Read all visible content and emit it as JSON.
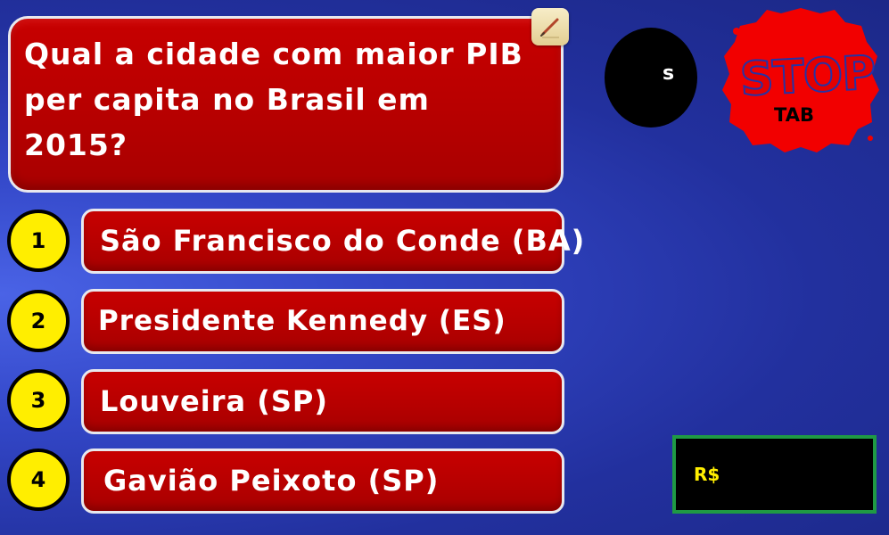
{
  "question": {
    "text_line1": "Qual a cidade com maior PIB",
    "text_line2": "per capita no Brasil em 2015?"
  },
  "edit_icon": "pencil-edit-icon",
  "answers": [
    {
      "number": "1",
      "text": "São Francisco do Conde (BA)"
    },
    {
      "number": "2",
      "text": "Presidente Kennedy (ES)"
    },
    {
      "number": "3",
      "text": "Louveira (SP)"
    },
    {
      "number": "4",
      "text": "Gavião Peixoto (SP)"
    }
  ],
  "timer": {
    "label": "s"
  },
  "stop_button": {
    "label": "STOP",
    "sublabel": "TAB"
  },
  "prize": {
    "label": "R$"
  },
  "colors": {
    "background": "#3347c8",
    "question_fill": "#c00000",
    "answer_fill": "#c00000",
    "number_circle": "#ffee00",
    "prize_border": "#1f9a44",
    "prize_text": "#ffee00"
  }
}
